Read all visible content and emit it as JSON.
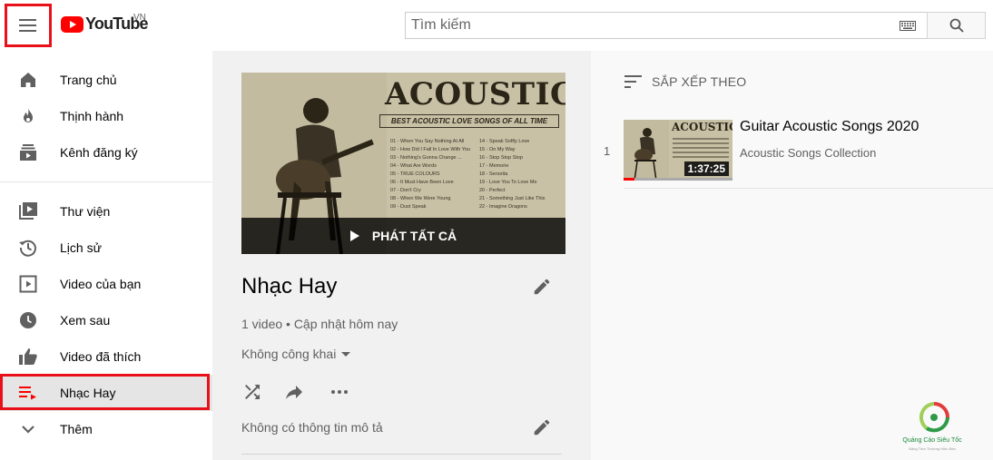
{
  "header": {
    "logo_text": "YouTube",
    "logo_region": "VN",
    "search_placeholder": "Tìm kiếm"
  },
  "sidebar": {
    "items": [
      {
        "label": "Trang chủ",
        "icon": "home-icon"
      },
      {
        "label": "Thịnh hành",
        "icon": "fire-icon"
      },
      {
        "label": "Kênh đăng ký",
        "icon": "subscriptions-icon"
      },
      {
        "label": "Thư viện",
        "icon": "library-icon"
      },
      {
        "label": "Lịch sử",
        "icon": "history-icon"
      },
      {
        "label": "Video của bạn",
        "icon": "play-square-icon"
      },
      {
        "label": "Xem sau",
        "icon": "clock-icon"
      },
      {
        "label": "Video đã thích",
        "icon": "thumb-up-icon"
      },
      {
        "label": "Nhạc Hay",
        "icon": "playlist-icon",
        "active": true
      },
      {
        "label": "Thêm",
        "icon": "chevron-down-icon"
      }
    ]
  },
  "playlist": {
    "thumbnail_title": "ACOUSTIC",
    "thumbnail_subtitle": "BEST ACOUSTIC LOVE SONGS OF ALL TIME",
    "thumbnail_tracks": [
      "01 - When You Say Nothing At All",
      "14 - Speak Softly Love",
      "02 - How Did I Fall In Love With You",
      "15 - On My Way",
      "03 - Nothing's Gonna Change ...",
      "16 - Stop Stop Stop",
      "04 - What Are Words",
      "17 - Memorie",
      "05 - TRUE COLOURS",
      "18 - Senorita",
      "06 - It Must Have Been Love",
      "19 - Love You To Love Me",
      "07 - Don't Cry",
      "20 - Perfect",
      "08 - When We Were Young",
      "21 - Something Just Like This",
      "09 - Dust Speak",
      "22 - Imagine Dragons"
    ],
    "play_all_label": "PHÁT TẤT CẢ",
    "title": "Nhạc Hay",
    "meta": "1 video • Cập nhật hôm nay",
    "privacy": "Không công khai",
    "description": "Không có thông tin mô tả"
  },
  "content": {
    "sort_label": "SẮP XẾP THEO",
    "videos": [
      {
        "index": "1",
        "thumbnail_title": "ACOUSTIC",
        "title": "Guitar Acoustic Songs 2020",
        "channel": "Acoustic Songs Collection",
        "duration": "1:37:25",
        "watched_fraction": 0.1
      }
    ]
  },
  "watermark": {
    "text": "Quảng Cáo Siêu Tốc",
    "subtext": "Nâng Tầm Thương Hiệu Bạn"
  },
  "colors": {
    "accent": "#ff0000",
    "highlight_frame": "#e8111a"
  }
}
